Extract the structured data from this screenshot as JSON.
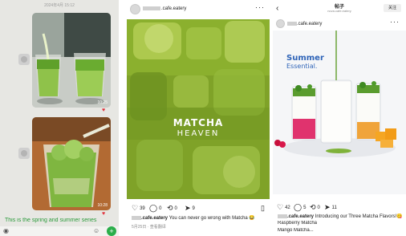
{
  "chat": {
    "date": "2024年4月 15:12",
    "photo1_time": "10:25",
    "photo2_time": "10:28",
    "caption": "This is the spring and summer series",
    "heart_icon": "heart-icon",
    "plus_icon": "plus-icon"
  },
  "post2": {
    "username": ".cafe.eatery",
    "more_icon": "more-icon",
    "image_title": "MATCHA",
    "image_subtitle": "HEAVEN",
    "likes": "39",
    "comments": "0",
    "reposts": "0",
    "shares": "9",
    "caption_user": ".cafe.eatery",
    "caption_text": "You can never go wrong with Matcha 😂",
    "translate": "5月25日 · 查看翻译"
  },
  "post3": {
    "title": "帖子",
    "handle": "nova.cafe.eatery",
    "follow": "关注",
    "username": ".cafe.eatery",
    "image_title": "Summer",
    "image_subtitle": "Essential.",
    "likes": "42",
    "comments": "5",
    "reposts": "0",
    "shares": "11",
    "caption_user": ".cafe.eatery",
    "caption_text": "Introducing our Three Matcha Flavors!😋",
    "line2": "Raspberry Matcha",
    "line3": "Mango Matcha..."
  },
  "colors": {
    "chat_bg": "#e7e7e3",
    "chat_green": "#2a9a3a",
    "matcha": "#7fa228",
    "summer_blue": "#2f64b8",
    "heart_red": "#e0303a"
  }
}
